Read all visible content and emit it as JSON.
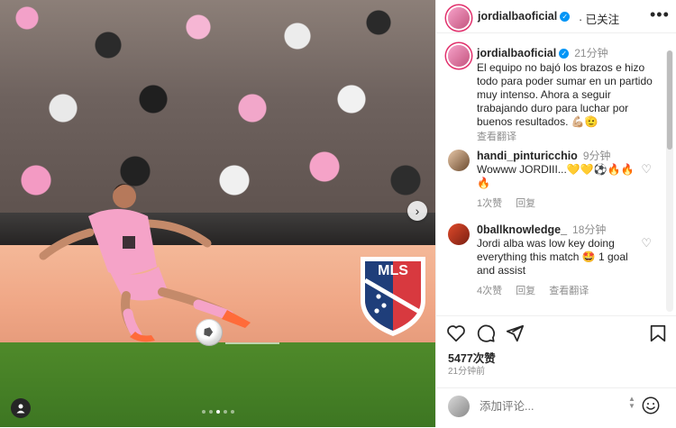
{
  "post": {
    "username": "jordialbaoficial",
    "follow_label": "已关注",
    "caption_time": "21分钟",
    "caption_text": "El equipo no bajó los brazos e hizo todo para poder sumar en un partido muy intenso. Ahora a seguir trabajando duro para luchar por buenos resultados. 💪🏼🫡",
    "see_translation": "查看翻译",
    "likes": "5477次赞",
    "posted_ago": "21分钟前",
    "comment_placeholder": "添加评论...",
    "photo": {
      "adboard_text": "MLS",
      "carousel_dots": 5,
      "active_dot": 3
    }
  },
  "comments": [
    {
      "username": "handi_pinturicchio",
      "time": "9分钟",
      "text": "Wowww JORDIII...💛💛⚽🔥🔥🔥",
      "likes": "1次赞",
      "reply": "回复",
      "translate": ""
    },
    {
      "username": "0ballknowledge_",
      "time": "18分钟",
      "text": "Jordi alba was low key doing everything this match 🤩 1 goal and assist",
      "likes": "4次赞",
      "reply": "回复",
      "translate": "查看翻译"
    }
  ],
  "icons": {
    "more": "more-horizontal-icon",
    "like": "heart-icon",
    "comment": "comment-bubble-icon",
    "share": "send-icon",
    "save": "bookmark-icon",
    "emoji": "emoji-icon",
    "next": "chevron-right-icon",
    "tagged_user": "user-icon"
  },
  "colors": {
    "accent_blue": "#0095f6",
    "text": "#262626",
    "muted": "#8e8e8e",
    "jersey_pink": "#f5a3c8"
  }
}
